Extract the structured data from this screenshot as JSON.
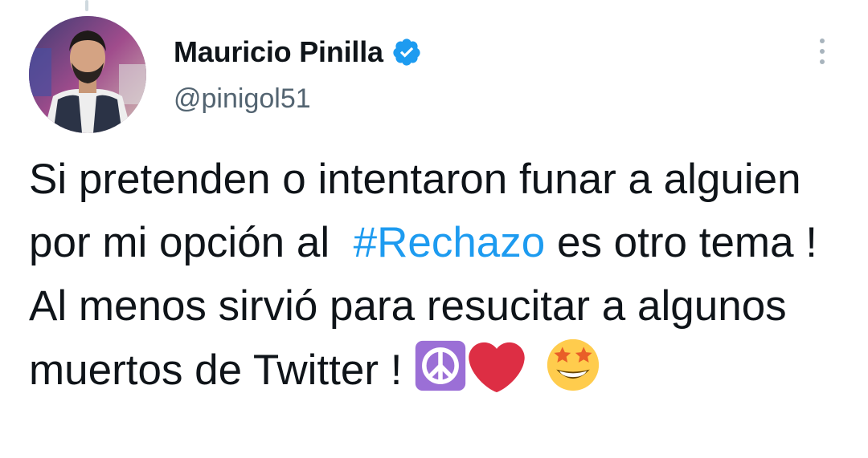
{
  "author": {
    "display_name": "Mauricio Pinilla",
    "handle": "@pinigol51",
    "verified": true
  },
  "tweet": {
    "text_before_hashtag": "Si pretenden o intentaron funar a alguien por mi opción al  ",
    "hashtag": "#Rechazo",
    "text_after_hashtag": " es otro tema ! Al menos sirvió para resucitar a algunos muertos de Twitter ! ",
    "emojis": [
      "peace-symbol",
      "red-heart",
      "star-struck"
    ]
  },
  "colors": {
    "text": "#0f1419",
    "secondary": "#536471",
    "link": "#1d9bf0",
    "verified": "#1d9bf0"
  }
}
